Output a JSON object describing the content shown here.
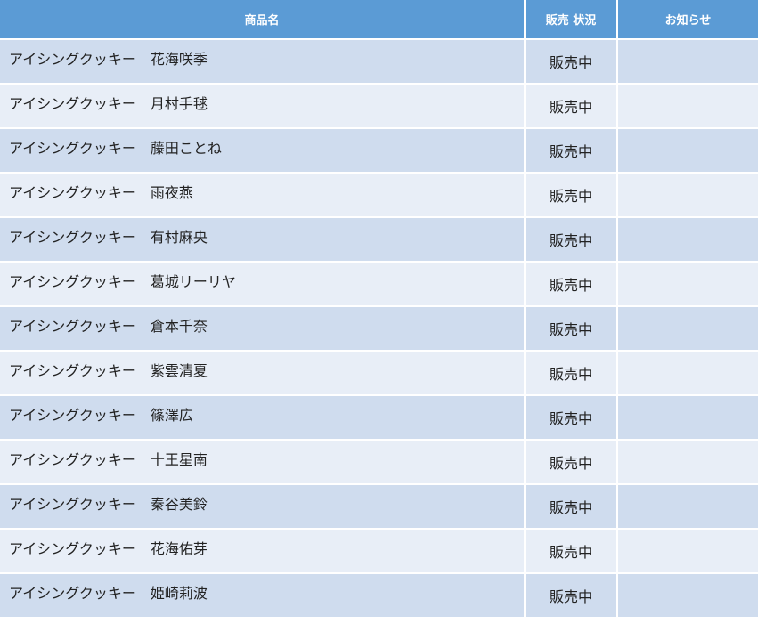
{
  "table": {
    "headers": {
      "name": "商品名",
      "status": "販売 状況",
      "notice": "お知らせ"
    },
    "rows": [
      {
        "name": "アイシングクッキー　花海咲季",
        "status": "販売中",
        "notice": ""
      },
      {
        "name": "アイシングクッキー　月村手毬",
        "status": "販売中",
        "notice": ""
      },
      {
        "name": "アイシングクッキー　藤田ことね",
        "status": "販売中",
        "notice": ""
      },
      {
        "name": "アイシングクッキー　雨夜燕",
        "status": "販売中",
        "notice": ""
      },
      {
        "name": "アイシングクッキー　有村麻央",
        "status": "販売中",
        "notice": ""
      },
      {
        "name": "アイシングクッキー　葛城リーリヤ",
        "status": "販売中",
        "notice": ""
      },
      {
        "name": "アイシングクッキー　倉本千奈",
        "status": "販売中",
        "notice": ""
      },
      {
        "name": "アイシングクッキー　紫雲清夏",
        "status": "販売中",
        "notice": ""
      },
      {
        "name": "アイシングクッキー　篠澤広",
        "status": "販売中",
        "notice": ""
      },
      {
        "name": "アイシングクッキー　十王星南",
        "status": "販売中",
        "notice": ""
      },
      {
        "name": "アイシングクッキー　秦谷美鈴",
        "status": "販売中",
        "notice": ""
      },
      {
        "name": "アイシングクッキー　花海佑芽",
        "status": "販売中",
        "notice": ""
      },
      {
        "name": "アイシングクッキー　姫崎莉波",
        "status": "販売中",
        "notice": ""
      }
    ]
  },
  "colors": {
    "header_bg": "#5b9bd5",
    "row_odd": "#cfdcee",
    "row_even": "#e8eef7"
  }
}
